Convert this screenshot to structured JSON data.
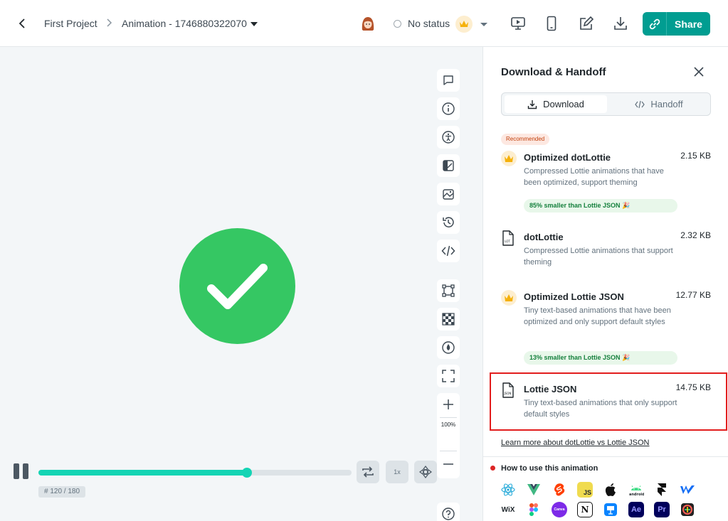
{
  "header": {
    "project": "First Project",
    "animation": "Animation - 1746880322070",
    "status": "No status",
    "share": "Share"
  },
  "player": {
    "frame": "# 120 / 180",
    "progress": 0.665,
    "speed": "1x",
    "zoom": "100%"
  },
  "panel": {
    "title": "Download & Handoff",
    "tabs": {
      "download": "Download",
      "handoff": "Handoff"
    },
    "recommended": "Recommended",
    "items": [
      {
        "name": "Optimized dotLottie",
        "size": "2.15 KB",
        "desc": "Compressed Lottie animations that have been optimized, support theming",
        "badge": "85% smaller than Lottie JSON 🎉",
        "icon": "crown-icon"
      },
      {
        "name": "dotLottie",
        "size": "2.32 KB",
        "desc": "Compressed Lottie animations that support theming",
        "icon": "lottie-file-icon"
      },
      {
        "name": "Optimized Lottie JSON",
        "size": "12.77 KB",
        "desc": "Tiny text-based animations that have been optimized and only support default styles",
        "badge": "13% smaller than Lottie JSON 🎉",
        "icon": "crown-icon"
      },
      {
        "name": "Lottie JSON",
        "size": "14.75 KB",
        "desc": "Tiny text-based animations that only support default styles",
        "icon": "json-file-icon"
      }
    ],
    "learn_more": "Learn more about dotLottie vs Lottie JSON",
    "how_to": "How to use this animation",
    "platforms": {
      "js": "JS",
      "wix": "WiX",
      "canva": "Canva",
      "notion": "N",
      "ae": "Ae",
      "pr": "Pr"
    }
  },
  "colors": {
    "accent": "#019d91",
    "success": "#35c763",
    "progress": "#14d4b4",
    "highlight": "#e21d1d"
  }
}
